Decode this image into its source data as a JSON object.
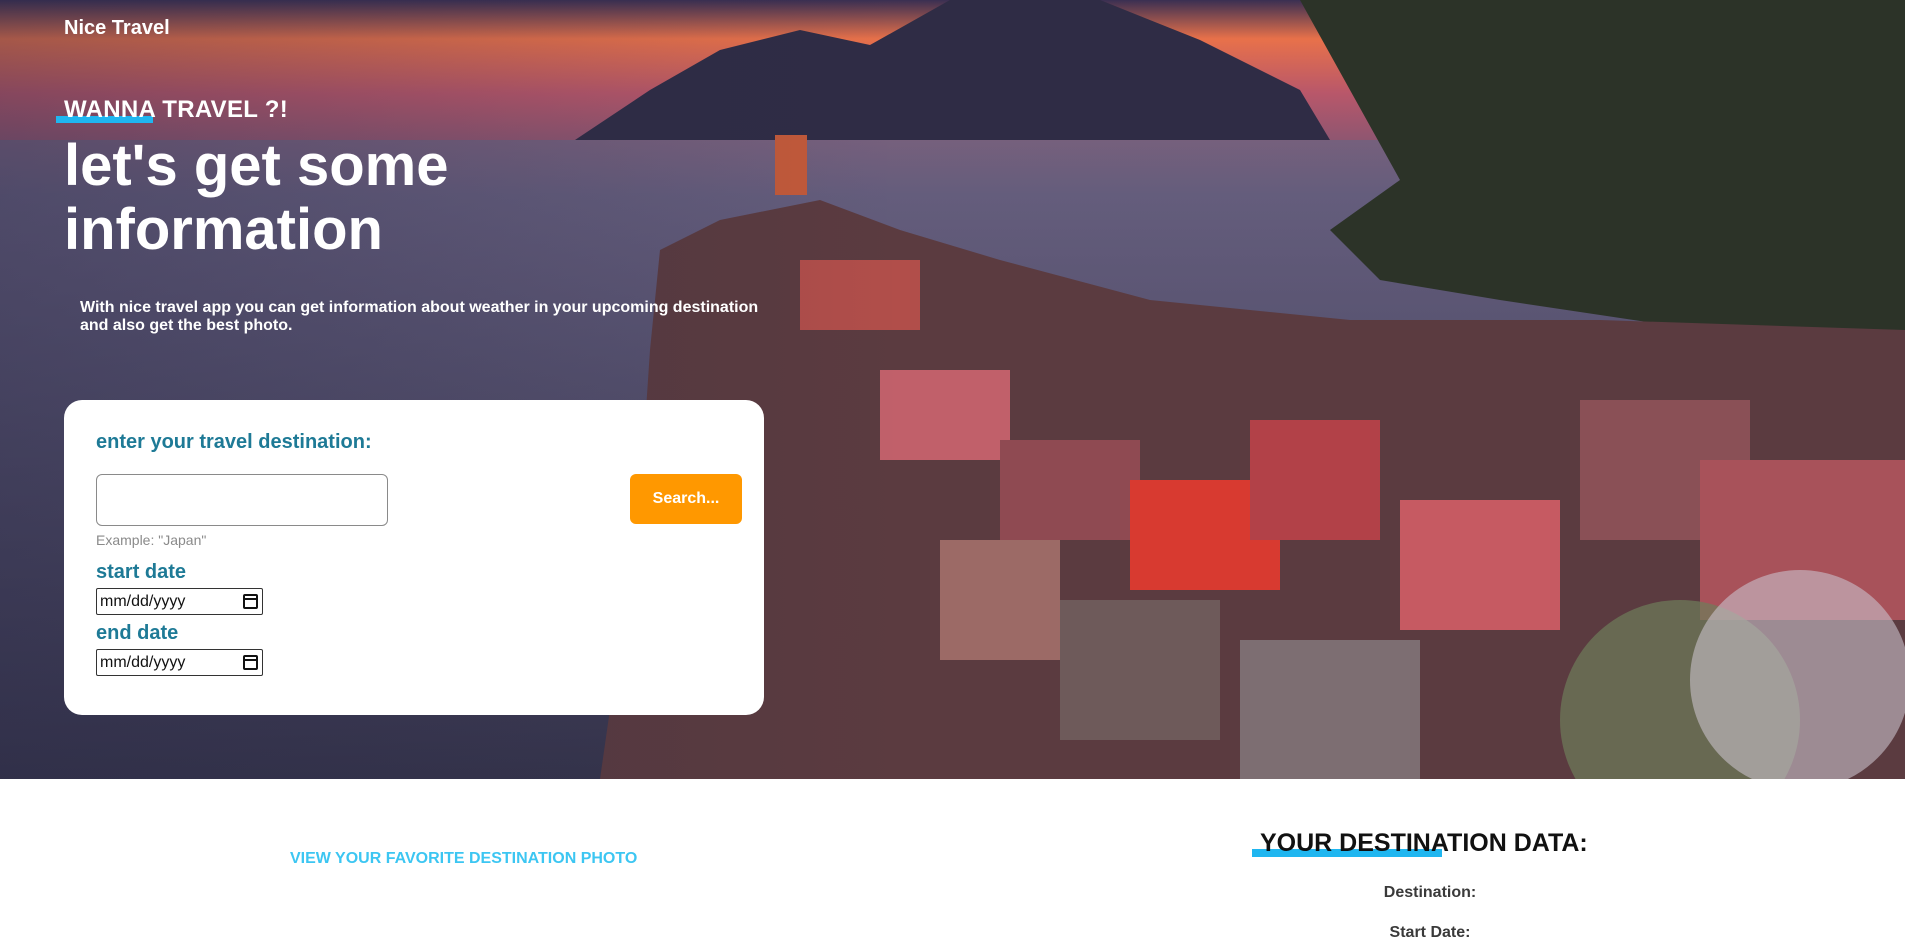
{
  "header": {
    "brand": "Nice Travel"
  },
  "hero": {
    "eyebrow": "WANNA TRAVEL ?!",
    "headline": "let's get some information",
    "intro": "With nice travel app you can get information about weather in your upcoming destination and also get the best photo."
  },
  "form": {
    "title": "enter your travel destination:",
    "destination_value": "",
    "hint": "Example: \"Japan\"",
    "search_label": "Search...",
    "start_label": "start date",
    "start_value": "mm/dd/yyyy",
    "end_label": "end date",
    "end_value": "mm/dd/yyyy"
  },
  "bottom": {
    "favorite_link": "VIEW YOUR FAVORITE DESTINATION PHOTO",
    "data_title": "YOUR DESTINATION DATA:",
    "destination_label": "Destination:",
    "start_label": "Start Date:"
  },
  "colors": {
    "accent_blue": "#1fb6f0",
    "link_blue": "#3cc6f2",
    "form_teal": "#1e7a96",
    "button_orange": "#ff9800"
  }
}
